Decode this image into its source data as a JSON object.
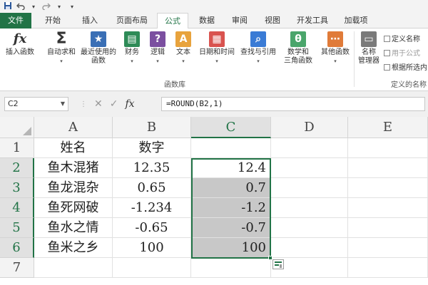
{
  "qat": {
    "save_icon": "save-icon",
    "undo_icon": "undo-icon",
    "redo_icon": "redo-icon",
    "more": "▾"
  },
  "tabs": [
    "文件",
    "开始",
    "插入",
    "页面布局",
    "公式",
    "数据",
    "审阅",
    "视图",
    "开发工具",
    "加载项"
  ],
  "active_tab": "公式",
  "ribbon": {
    "buttons": [
      {
        "label": "插入函数",
        "icon": "fx-icon",
        "color": "#ffffff"
      },
      {
        "label": "自动求和",
        "icon": "sigma-icon",
        "color": "#ffffff"
      },
      {
        "label": "最近使用的",
        "label2": "函数",
        "icon": "star-icon",
        "color": "#3a6fb5"
      },
      {
        "label": "财务",
        "icon": "finance-icon",
        "color": "#2e8b57"
      },
      {
        "label": "逻辑",
        "icon": "question-icon",
        "color": "#7b4fa0"
      },
      {
        "label": "文本",
        "icon": "text-A-icon",
        "color": "#e8a33d"
      },
      {
        "label": "日期和时间",
        "icon": "calendar-icon",
        "color": "#d9534f"
      },
      {
        "label": "查找与引用",
        "icon": "magnifier-icon",
        "color": "#3a7bd5"
      },
      {
        "label": "数学和",
        "label2": "三角函数",
        "icon": "theta-icon",
        "color": "#4aa56b"
      },
      {
        "label": "其他函数",
        "icon": "more-functions-icon",
        "color": "#e07b39"
      },
      {
        "label": "名称",
        "label2": "管理器",
        "icon": "name-manager-icon",
        "color": "#7a7a7a"
      }
    ],
    "group_label": "函数库",
    "side_items": [
      "定义名称",
      "用于公式",
      "根据所选内"
    ],
    "side_group_label": "定义的名称"
  },
  "formula_bar": {
    "name_box": "C2",
    "formula": "=ROUND(B2,1)",
    "cancel": "✕",
    "enter": "✓",
    "fx": "fx"
  },
  "sheet": {
    "columns": [
      "A",
      "B",
      "C",
      "D",
      "E"
    ],
    "rows": [
      "1",
      "2",
      "3",
      "4",
      "5",
      "6",
      "7"
    ],
    "cells": [
      [
        "姓名",
        "数字",
        ""
      ],
      [
        "鱼木混猪",
        "12.35",
        "12.4"
      ],
      [
        "鱼龙混杂",
        "0.65",
        "0.7"
      ],
      [
        "鱼死网破",
        "-1.234",
        "-1.2"
      ],
      [
        "鱼水之情",
        "-0.65",
        "-0.7"
      ],
      [
        "鱼米之乡",
        "100",
        "100"
      ],
      [
        "",
        "",
        ""
      ]
    ],
    "active_cell": "C2",
    "selection": "C2:C6",
    "accent": "#217346"
  }
}
